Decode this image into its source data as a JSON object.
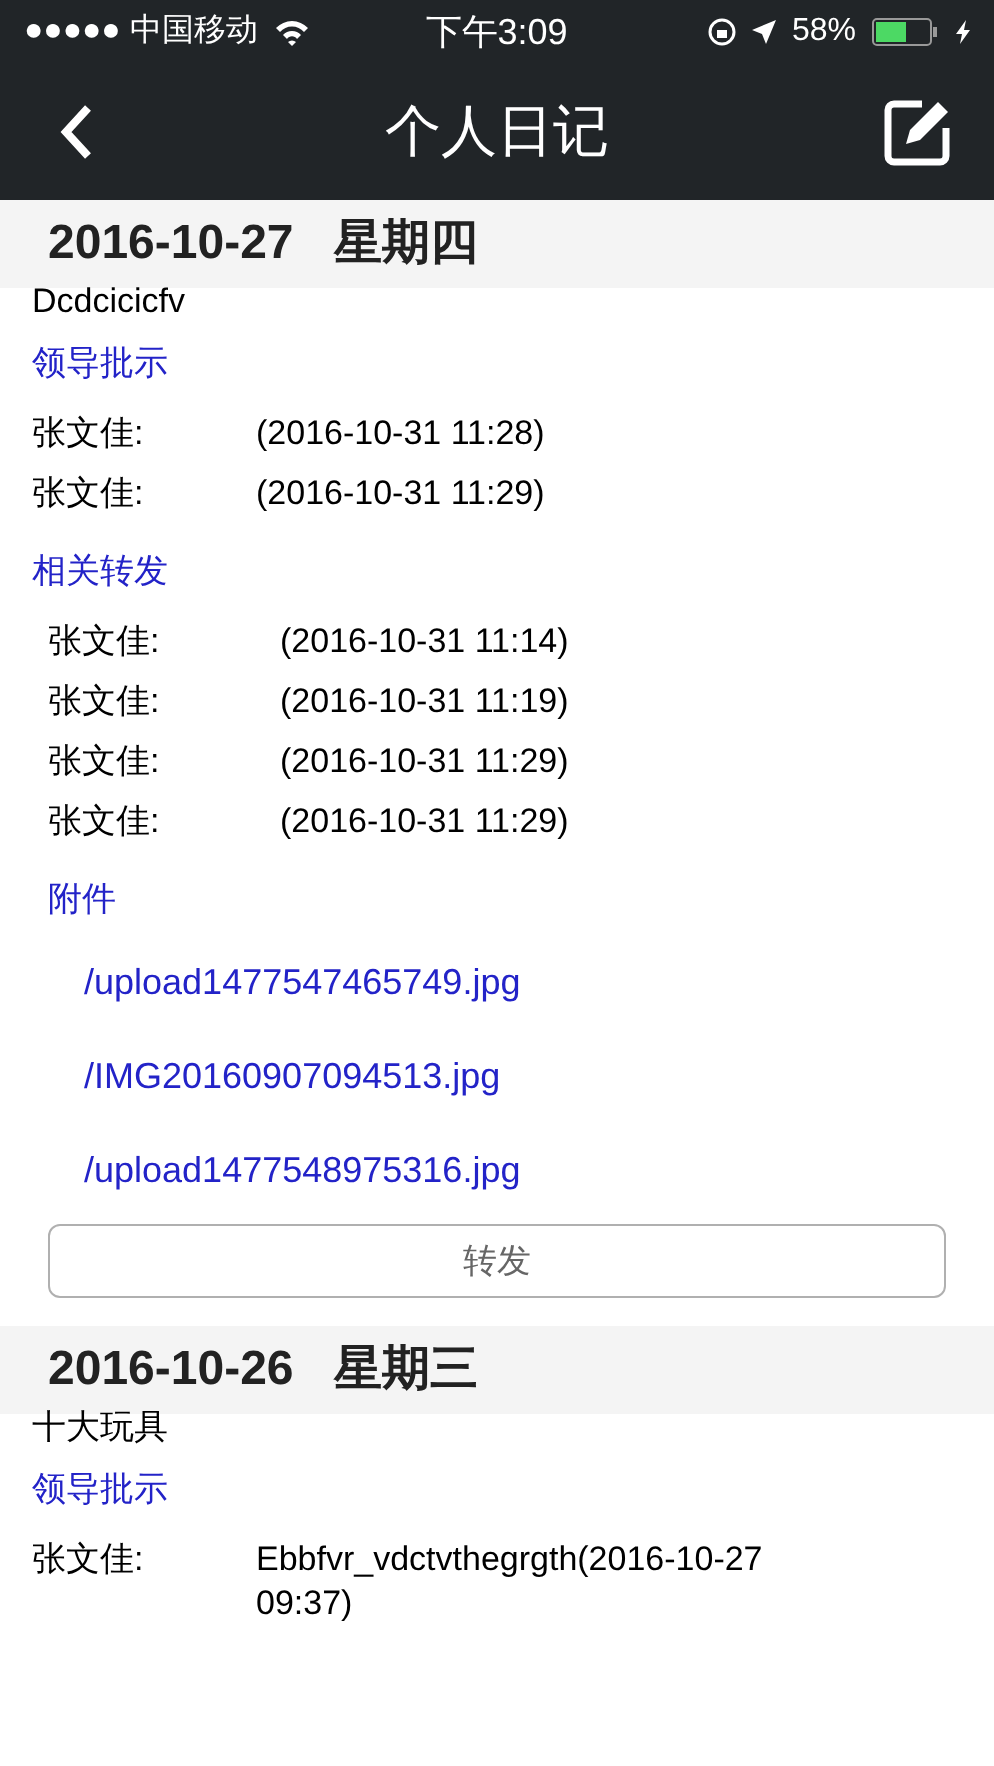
{
  "status_bar": {
    "carrier": "●●●●● 中国移动",
    "time": "下午3:09",
    "battery": "58%"
  },
  "nav": {
    "title": "个人日记"
  },
  "entries": [
    {
      "date": "2016-10-27",
      "weekday": "星期四",
      "content": "Dcdcicicfv",
      "approvals_heading": "领导批示",
      "approvals": [
        {
          "name": "张文佳:",
          "text": "(2016-10-31 11:28)"
        },
        {
          "name": "张文佳:",
          "text": "(2016-10-31 11:29)"
        }
      ],
      "forwards_heading": "相关转发",
      "forwards": [
        {
          "name": "张文佳:",
          "text": "(2016-10-31 11:14)"
        },
        {
          "name": "张文佳:",
          "text": "(2016-10-31 11:19)"
        },
        {
          "name": "张文佳:",
          "text": "(2016-10-31 11:29)"
        },
        {
          "name": "张文佳:",
          "text": "(2016-10-31 11:29)"
        }
      ],
      "attachments_heading": "附件",
      "attachments": [
        "/upload1477547465749.jpg",
        "/IMG20160907094513.jpg",
        "/upload1477548975316.jpg"
      ],
      "forward_button": "转发"
    },
    {
      "date": "2016-10-26",
      "weekday": "星期三",
      "content": "十大玩具",
      "approvals_heading": "领导批示",
      "approvals": [
        {
          "name": "张文佳:",
          "text": "Ebbfvr_vdctvthegrgth(2016-10-27 09:37)"
        }
      ]
    }
  ]
}
